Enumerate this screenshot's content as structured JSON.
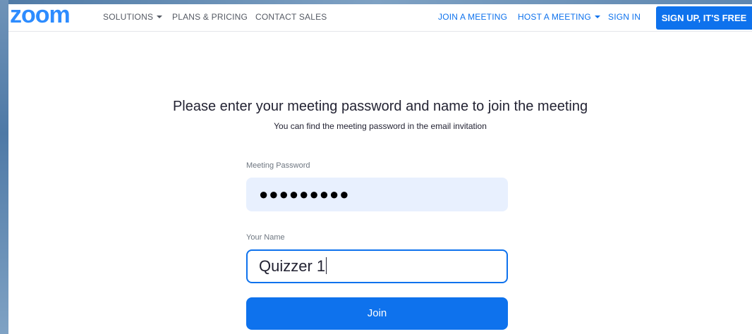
{
  "brand": {
    "logo_text": "zoom",
    "accent_color": "#0e72ed",
    "logo_color": "#2d8cff"
  },
  "nav": {
    "left_items": [
      {
        "label": "SOLUTIONS",
        "has_dropdown": true
      },
      {
        "label": "PLANS & PRICING",
        "has_dropdown": false
      },
      {
        "label": "CONTACT SALES",
        "has_dropdown": false
      }
    ],
    "right_items": [
      {
        "label": "JOIN A MEETING",
        "has_dropdown": false
      },
      {
        "label": "HOST A MEETING",
        "has_dropdown": true
      },
      {
        "label": "SIGN IN",
        "has_dropdown": false
      }
    ],
    "signup_label": "SIGN UP, IT'S FREE"
  },
  "form": {
    "heading": "Please enter your meeting password and name to join the meeting",
    "subheading": "You can find the meeting password in the email invitation",
    "password_label": "Meeting Password",
    "password_masked": "●●●●●●●●●",
    "name_label": "Your Name",
    "name_value": "Quizzer 1",
    "join_label": "Join"
  }
}
